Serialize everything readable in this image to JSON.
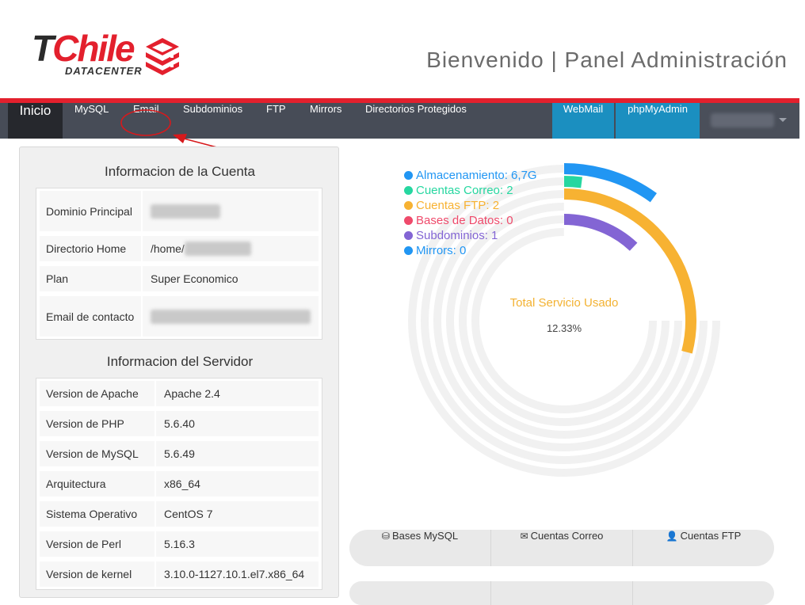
{
  "header": {
    "logo_main": "Chile",
    "logo_t": "T",
    "logo_sub": "DATACENTER",
    "title": "Bienvenido | Panel Administración"
  },
  "nav": {
    "home": "Inicio",
    "items": [
      "MySQL",
      "Email",
      "Subdominios",
      "FTP",
      "Mirrors",
      "Directorios Protegidos"
    ],
    "webmail": "WebMail",
    "phpmyadmin": "phpMyAdmin"
  },
  "account": {
    "heading": "Informacion de la Cuenta",
    "rows": [
      {
        "label": "Dominio Principal",
        "value": ""
      },
      {
        "label": "Directorio Home",
        "value": "/home/"
      },
      {
        "label": "Plan",
        "value": "Super Economico"
      },
      {
        "label": "Email de contacto",
        "value": ""
      }
    ]
  },
  "server": {
    "heading": "Informacion del Servidor",
    "rows": [
      {
        "label": "Version de Apache",
        "value": "Apache 2.4"
      },
      {
        "label": "Version de PHP",
        "value": "5.6.40"
      },
      {
        "label": "Version de MySQL",
        "value": "5.6.49"
      },
      {
        "label": "Arquitectura",
        "value": "x86_64"
      },
      {
        "label": "Sistema Operativo",
        "value": "CentOS 7"
      },
      {
        "label": "Version de Perl",
        "value": "5.16.3"
      },
      {
        "label": "Version de kernel",
        "value": "3.10.0-1127.10.1.el7.x86_64"
      }
    ]
  },
  "usage": {
    "legend": [
      {
        "label": "Almacenamiento: 6,7G",
        "color": "#2196f3",
        "fraction": 0.1
      },
      {
        "label": "Cuentas Correo: 2",
        "color": "#26d7a0",
        "fraction": 0.02
      },
      {
        "label": "Cuentas FTP: 2",
        "color": "#f7b232",
        "fraction": 0.29
      },
      {
        "label": "Bases de Datos: 0",
        "color": "#ef4a6b",
        "fraction": 0.0
      },
      {
        "label": "Subdominios: 1",
        "color": "#8365d4",
        "fraction": 0.12
      },
      {
        "label": "Mirrors: 0",
        "color": "#2196f3",
        "fraction": 0.0
      }
    ],
    "total_label": "Total Servicio Usado",
    "total_value": "12.33%"
  },
  "tabs": [
    {
      "icon": "database-icon",
      "label": "Bases MySQL"
    },
    {
      "icon": "envelope-icon",
      "label": "Cuentas Correo"
    },
    {
      "icon": "user-icon",
      "label": "Cuentas FTP"
    }
  ]
}
